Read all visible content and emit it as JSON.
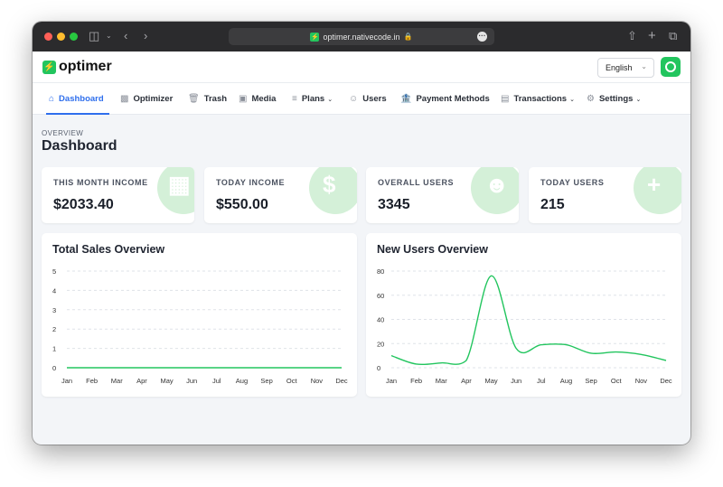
{
  "browser": {
    "url": "optimer.nativecode.in",
    "traffic_lights": [
      "#fe5f57",
      "#febc2e",
      "#28c840"
    ]
  },
  "app": {
    "brand": "optimer",
    "brand_color": "#22c55e",
    "accent_color": "#2f6fed",
    "language": "English"
  },
  "nav": {
    "items": [
      {
        "label": "Dashboard",
        "icon": "home-icon",
        "active": true
      },
      {
        "label": "Optimizer",
        "icon": "optimizer-icon"
      },
      {
        "label": "Trash",
        "icon": "trash-icon"
      },
      {
        "label": "Media",
        "icon": "image-icon"
      },
      {
        "label": "Plans",
        "icon": "list-icon",
        "dropdown": true
      },
      {
        "label": "Users",
        "icon": "users-icon"
      },
      {
        "label": "Payment Methods",
        "icon": "bank-icon"
      },
      {
        "label": "Transactions",
        "icon": "receipt-icon",
        "dropdown": true
      },
      {
        "label": "Settings",
        "icon": "gear-icon",
        "dropdown": true
      }
    ]
  },
  "page": {
    "eyebrow": "OVERVIEW",
    "title": "Dashboard"
  },
  "stats": [
    {
      "label": "THIS MONTH INCOME",
      "value": "$2033.40",
      "icon": "calendar-money-icon"
    },
    {
      "label": "TODAY INCOME",
      "value": "$550.00",
      "icon": "money-stack-icon"
    },
    {
      "label": "OVERALL USERS",
      "value": "3345",
      "icon": "users-icon"
    },
    {
      "label": "TODAY USERS",
      "value": "215",
      "icon": "user-add-icon"
    }
  ],
  "chart_data": [
    {
      "type": "line",
      "title": "Total Sales Overview",
      "categories": [
        "Jan",
        "Feb",
        "Mar",
        "Apr",
        "May",
        "Jun",
        "Jul",
        "Aug",
        "Sep",
        "Oct",
        "Nov",
        "Dec"
      ],
      "series": [
        {
          "values": [
            0,
            0,
            0,
            0,
            0,
            0,
            0,
            0,
            0,
            0,
            0,
            0
          ]
        }
      ],
      "ylim": [
        0,
        5
      ],
      "yticks": [
        0,
        1,
        2,
        3,
        4,
        5
      ],
      "grid": true,
      "color": "#22c55e"
    },
    {
      "type": "line",
      "title": "New Users Overview",
      "categories": [
        "Jan",
        "Feb",
        "Mar",
        "Apr",
        "May",
        "Jun",
        "Jul",
        "Aug",
        "Sep",
        "Oct",
        "Nov",
        "Dec"
      ],
      "series": [
        {
          "values": [
            10,
            3,
            4,
            6,
            76,
            16,
            19,
            19,
            12,
            13,
            11,
            6
          ]
        }
      ],
      "ylim": [
        0,
        80
      ],
      "yticks": [
        0,
        20,
        40,
        60,
        80
      ],
      "grid": true,
      "color": "#22c55e"
    }
  ]
}
